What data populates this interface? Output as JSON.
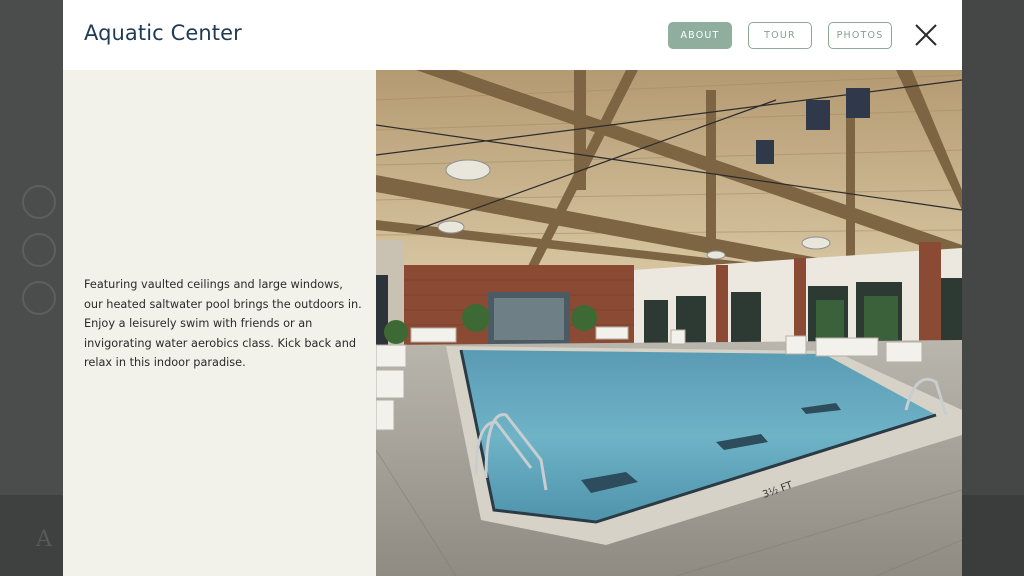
{
  "modal": {
    "title": "Aquatic Center",
    "tabs": [
      {
        "label": "ABOUT",
        "active": true
      },
      {
        "label": "TOUR",
        "active": false
      },
      {
        "label": "PHOTOS",
        "active": false
      }
    ],
    "description": "Featuring vaulted ceilings and large windows, our heated saltwater pool brings the outdoors in. Enjoy a leisurely swim with friends or an invigorating water aerobics class. Kick back and relax in this indoor paradise.",
    "photo": {
      "pool_depth_marking": "3½ FT"
    }
  },
  "background": {
    "partial_heading": "A"
  },
  "icons": [
    "close-icon"
  ],
  "colors": {
    "title": "#1f3b55",
    "tab_active_bg": "#8fae9e",
    "tab_border": "#8fa89a",
    "panel_bg": "#f2f1ea"
  }
}
